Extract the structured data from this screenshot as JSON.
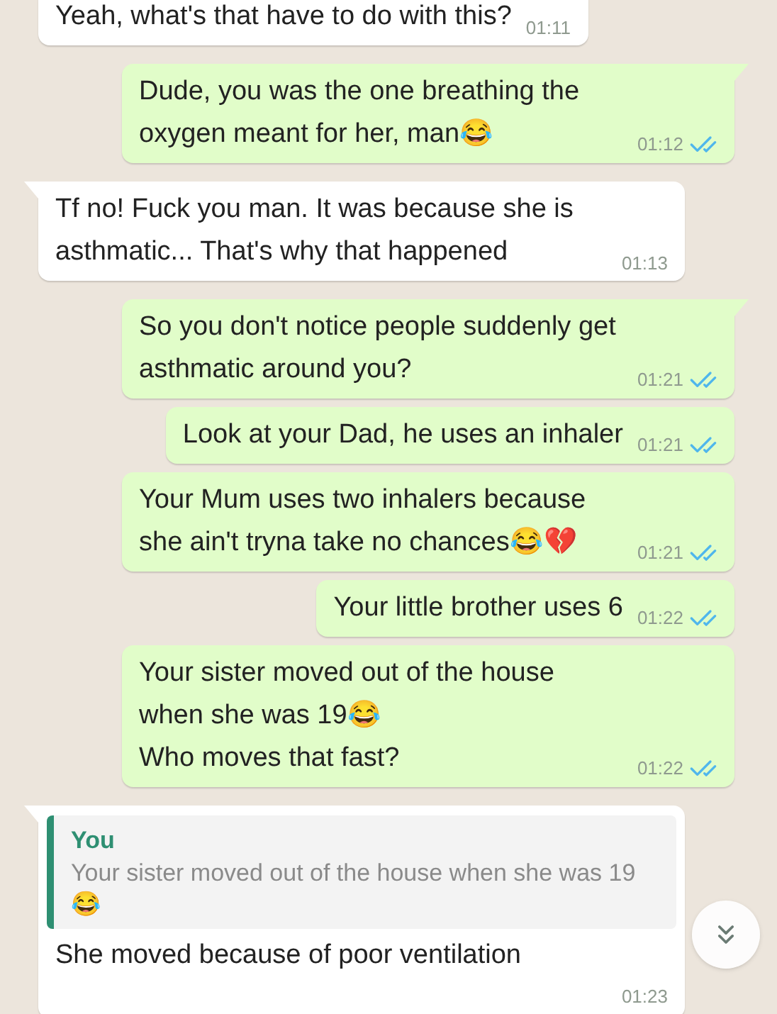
{
  "messages": [
    {
      "kind": "incoming",
      "tail": false,
      "text": "Yeah, what's that have to do with this?",
      "time": "01:11"
    },
    {
      "kind": "outgoing",
      "tail": true,
      "text": "Dude, you was the one breathing the oxygen meant for her, man😂",
      "time": "01:12",
      "read": true
    },
    {
      "kind": "incoming",
      "tail": true,
      "text": "Tf no! Fuck you man. It was because she is asthmatic... That's why that happened",
      "time": "01:13"
    },
    {
      "kind": "outgoing",
      "tail": true,
      "text": "So you don't notice people suddenly get asthmatic around you?",
      "time": "01:21",
      "read": true
    },
    {
      "kind": "outgoing",
      "tail": false,
      "text": "Look at your Dad, he uses an inhaler",
      "time": "01:21",
      "read": true
    },
    {
      "kind": "outgoing",
      "tail": false,
      "text": "Your Mum uses two inhalers because she ain't tryna take no chances😂💔",
      "time": "01:21",
      "read": true
    },
    {
      "kind": "outgoing",
      "tail": false,
      "text": "Your little brother uses 6",
      "time": "01:22",
      "read": true
    },
    {
      "kind": "outgoing",
      "tail": false,
      "text": "Your sister moved out of the house when she was 19😂\nWho moves that fast?",
      "time": "01:22",
      "read": true
    },
    {
      "kind": "incoming",
      "tail": true,
      "quote": {
        "author": "You",
        "text": "Your sister moved out of the house when she was 19😂"
      },
      "text": "She moved because of poor ventilation",
      "time": "01:23"
    }
  ]
}
